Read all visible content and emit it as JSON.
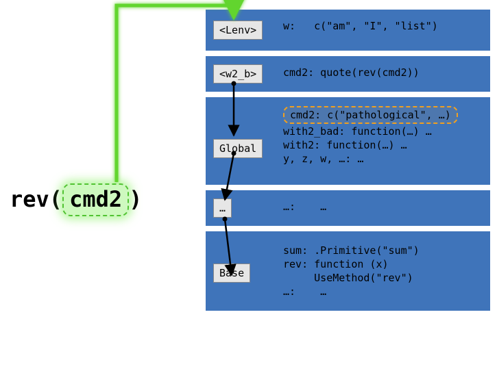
{
  "left_expr": {
    "func": "rev",
    "open": "(",
    "arg": "cmd2",
    "close": ")"
  },
  "envs": {
    "lenv": {
      "label": "<Lenv>",
      "line1": "w:   c(\"am\", \"I\", \"list\")"
    },
    "w2b": {
      "label": "<w2_b>",
      "line1": "cmd2: quote(rev(cmd2))"
    },
    "global": {
      "label": "Global",
      "hl": "cmd2: c(\"pathological\", …)",
      "l2": "with2_bad: function(…) …",
      "l3": "with2: function(…) …",
      "l4": "y, z, w, …: …"
    },
    "dots": {
      "label": "…",
      "line1": "…:    …"
    },
    "base": {
      "label": "Base",
      "l1": "sum: .Primitive(\"sum\")",
      "l2": "rev: function (x)",
      "l3": "     UseMethod(\"rev\")",
      "l4": "…:    …"
    }
  }
}
